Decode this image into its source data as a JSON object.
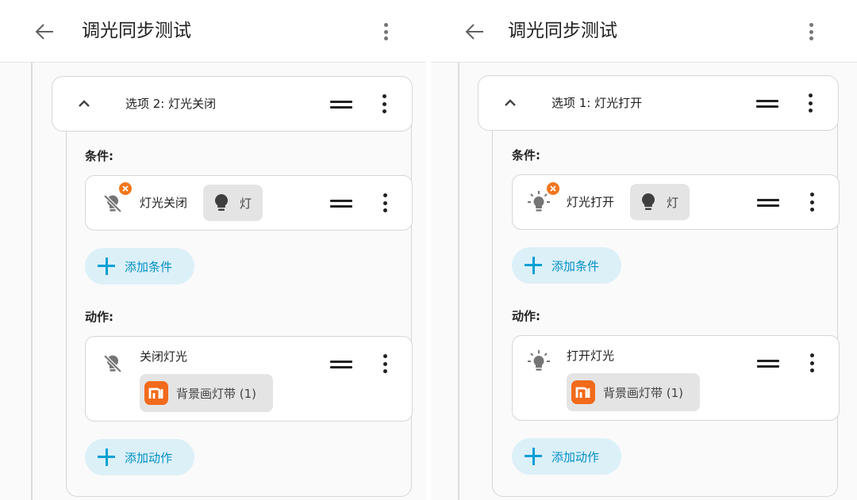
{
  "colors": {
    "accent": "#03a0d6",
    "accent_bg": "#dcf0f8",
    "badge": "#f2761d",
    "mi_brand": "#f26a1b",
    "chip_bg": "#e4e4e4"
  },
  "panels": [
    {
      "title": "调光同步测试",
      "back_icon": "arrow-left-icon",
      "menu_icon": "more-vertical-icon",
      "option": {
        "label": "选项 2: 灯光关闭",
        "expanded": true
      },
      "conditions_label": "条件:",
      "condition": {
        "icon": "lightbulb-off-icon",
        "label": "灯光关闭",
        "entity_icon": "lightbulb-icon",
        "entity": "灯"
      },
      "add_condition": "添加条件",
      "actions_label": "动作:",
      "action": {
        "icon": "lightbulb-off-icon",
        "label": "关闭灯光",
        "target_icon": "mi-logo-icon",
        "target": "背景画灯带 (1)"
      },
      "add_action": "添加动作"
    },
    {
      "title": "调光同步测试",
      "back_icon": "arrow-left-icon",
      "menu_icon": "more-vertical-icon",
      "option": {
        "label": "选项 1: 灯光打开",
        "expanded": true
      },
      "conditions_label": "条件:",
      "condition": {
        "icon": "lightbulb-on-icon",
        "label": "灯光打开",
        "entity_icon": "lightbulb-icon",
        "entity": "灯"
      },
      "add_condition": "添加条件",
      "actions_label": "动作:",
      "action": {
        "icon": "lightbulb-on-icon",
        "label": "打开灯光",
        "target_icon": "mi-logo-icon",
        "target": "背景画灯带 (1)"
      },
      "add_action": "添加动作"
    }
  ]
}
